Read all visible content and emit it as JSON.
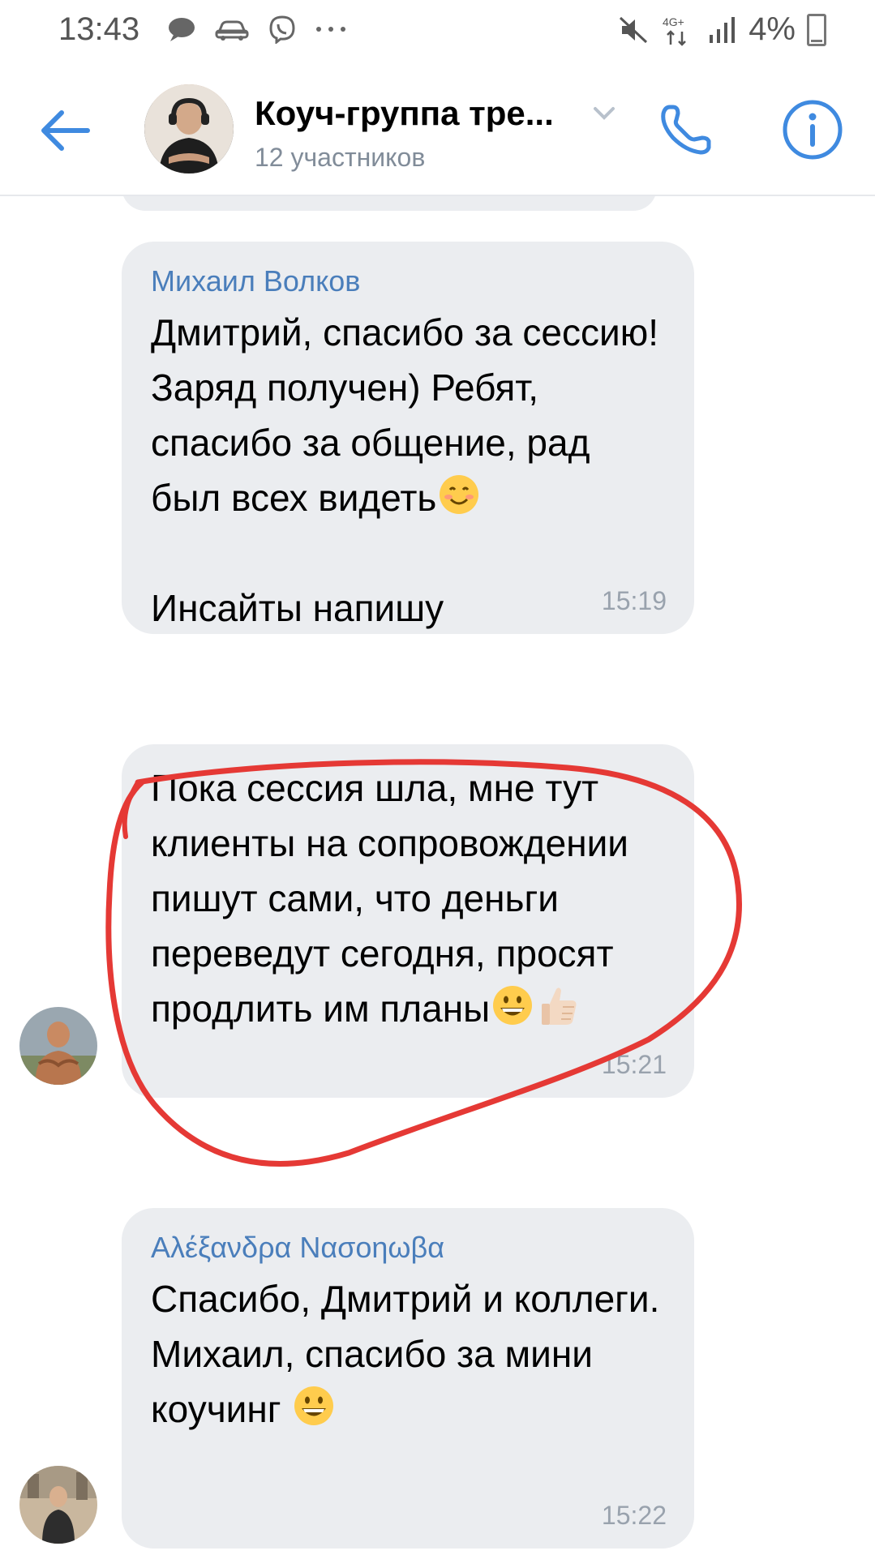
{
  "status_bar": {
    "time": "13:43",
    "network": "4G+",
    "battery": "4%"
  },
  "header": {
    "title": "Коуч-группа тре...",
    "subtitle": "12 участников"
  },
  "messages": [
    {
      "sender": "Михаил Волков",
      "text": "Дмитрий, спасибо за сессию! Заряд получен) Ребят, спасибо за общение, рад был всех видеть",
      "emoji": "smile",
      "text2": "Инсайты напишу",
      "time": "15:19"
    },
    {
      "sender": "",
      "text": "Пока сессия шла, мне тут клиенты на сопровождении пишут сами, что деньги переведут сегодня, просят продлить им планы",
      "emoji": "grin thumbs-up",
      "time": "15:21"
    },
    {
      "sender": "Αλέξανδρα Νασοηωβα",
      "text": "Спасибо, Дмитрий и коллеги.\nМихаил, спасибо за мини коучинг",
      "emoji": "grin",
      "time": "15:22"
    }
  ],
  "colors": {
    "accent": "#3f8ae0",
    "bubble": "#ebedf0",
    "sender": "#4a7ebb",
    "annotation": "#e53935"
  }
}
